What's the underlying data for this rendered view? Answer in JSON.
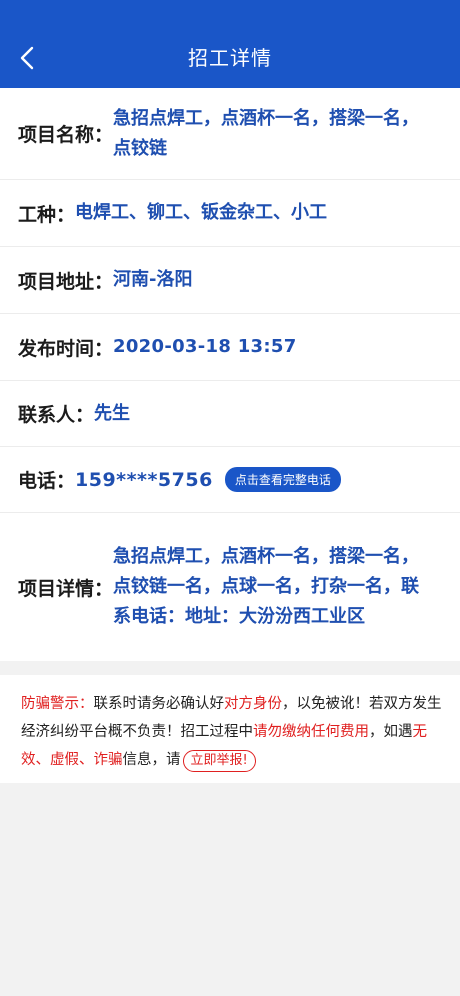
{
  "header": {
    "title": "招工详情"
  },
  "detail": {
    "project_name_label": "项目名称：",
    "project_name": "急招点焊工，点酒杯一名，搭梁一名，点铰链",
    "trade_label": "工种：",
    "trade": "电焊工、铆工、钣金杂工、小工",
    "address_label": "项目地址：",
    "address": "河南-洛阳",
    "publish_label": "发布时间：",
    "publish_time": "2020-03-18 13:57",
    "contact_label": "联系人：",
    "contact": "先生",
    "phone_label": "电话：",
    "phone": "159****5756",
    "phone_button": "点击查看完整电话",
    "details_label": "项目详情：",
    "details": "急招点焊工，点酒杯一名，搭梁一名，点铰链一名，点球一名，打杂一名，联系电话：地址：大汾汾西工业区"
  },
  "warning": {
    "title": "防骗警示：",
    "t1": "联系时请务必确认好",
    "r1": "对方身份",
    "t2": "，以免被讹！若双方发生经济纠纷平台概不负责！招工过程中",
    "r2": "请勿缴纳任何费用",
    "t3": "，如遇",
    "r3": "无效、虚假、诈骗",
    "t4": "信息，请",
    "report_button": "立即举报!"
  },
  "colors": {
    "header": "#1a56c8",
    "value_text": "#1f4fb0",
    "warning": "#e02020"
  },
  "icons": {
    "back": "chevron-left-icon"
  }
}
